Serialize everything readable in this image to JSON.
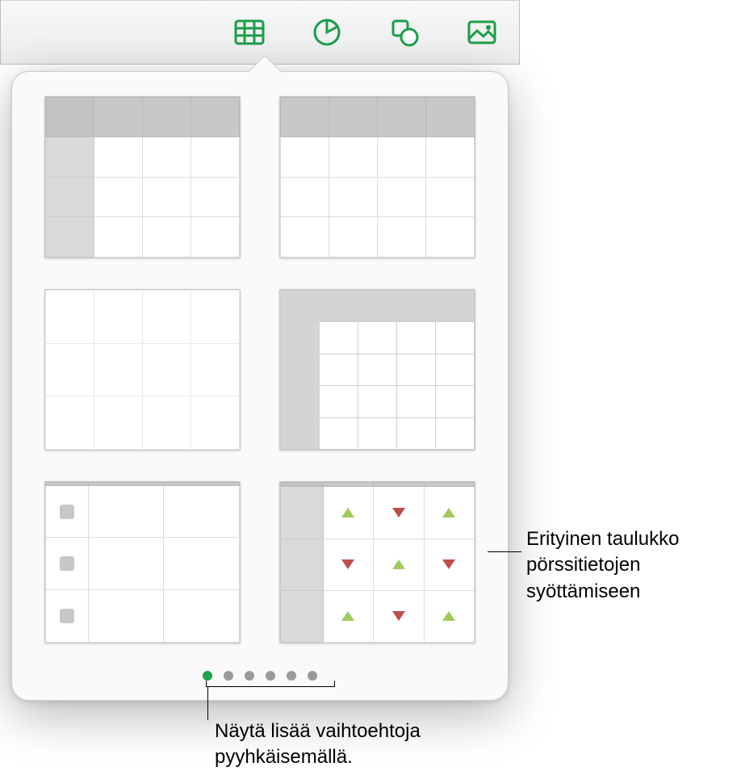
{
  "toolbar": {
    "icons": [
      {
        "name": "table-icon",
        "active": true
      },
      {
        "name": "chart-icon",
        "active": false
      },
      {
        "name": "shape-icon",
        "active": false
      },
      {
        "name": "image-icon",
        "active": false
      }
    ]
  },
  "popover": {
    "templates": [
      {
        "key": "header-row-col",
        "name": "table-template-header-row-and-column"
      },
      {
        "key": "header-row",
        "name": "table-template-header-row"
      },
      {
        "key": "plain",
        "name": "table-template-plain"
      },
      {
        "key": "outline",
        "name": "table-template-header-row-col-outline"
      },
      {
        "key": "checklist",
        "name": "table-template-checklist"
      },
      {
        "key": "stock",
        "name": "table-template-stock"
      }
    ],
    "page_dots": {
      "count": 6,
      "active_index": 0
    }
  },
  "callouts": {
    "stock": "Erityinen taulukko pörssitietojen syöttämiseen",
    "swipe": "Näytä lisää vaihtoehtoja pyyhkäisemällä."
  },
  "colors": {
    "accent": "#1a9e49",
    "up": "#9fca5a",
    "down": "#c14b4b"
  }
}
